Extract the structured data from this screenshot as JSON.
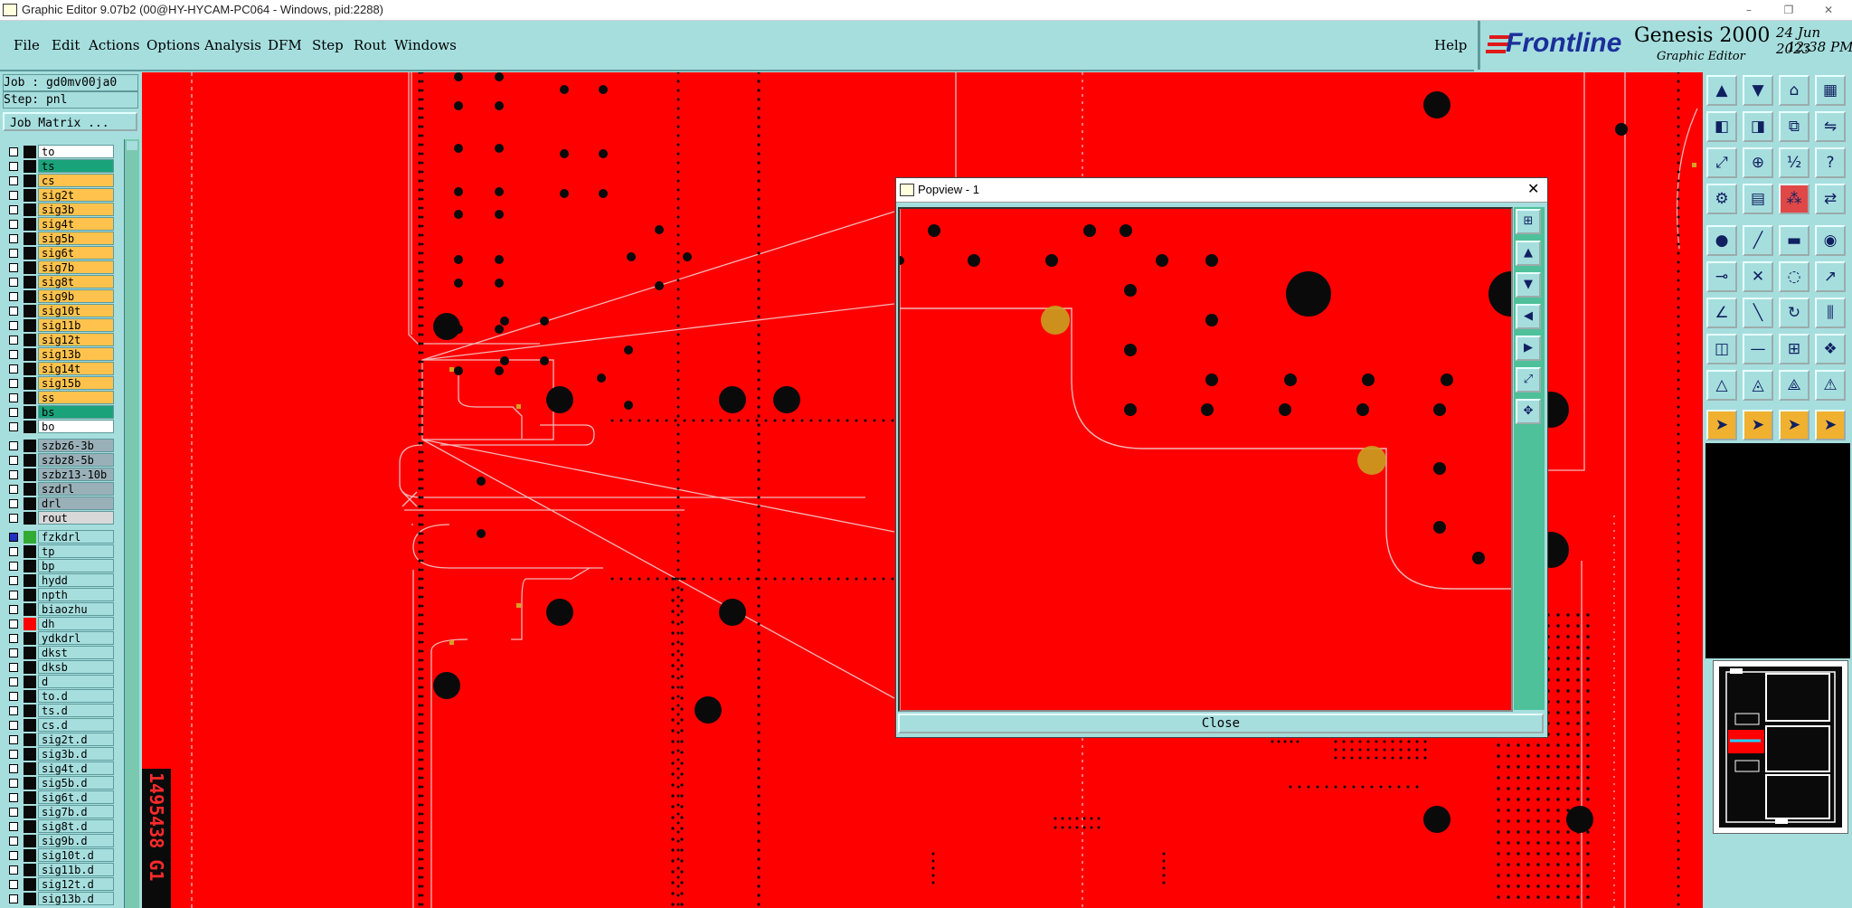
{
  "window": {
    "title": "Graphic Editor 9.07b2 (00@HY-HYCAM-PC064 - Windows, pid:2288)",
    "controls": [
      "–",
      "❐",
      "✕"
    ]
  },
  "menubar": {
    "items": [
      "File",
      "Edit",
      "Actions",
      "Options",
      "Analysis",
      "DFM",
      "Step",
      "Rout",
      "Windows"
    ],
    "help": "Help"
  },
  "brand": {
    "logo": "Frontline",
    "product": "Genesis 2000",
    "subtitle": "Graphic Editor",
    "date": "24 Jun 2023",
    "time": "12:38 PM"
  },
  "job": {
    "job_label": "Job : gd0mv00ja0",
    "step_label": "Step: pnl",
    "matrix_button": "Job Matrix ..."
  },
  "layers_group1": [
    {
      "name": "to",
      "color": "#ffffff",
      "swatch": "#0a0a0a"
    },
    {
      "name": "ts",
      "color": "#1aa37a",
      "swatch": "#0a0a0a"
    },
    {
      "name": "cs",
      "color": "#ffc34d",
      "swatch": "#0a0a0a"
    },
    {
      "name": "sig2t",
      "color": "#ffc34d",
      "swatch": "#0a0a0a"
    },
    {
      "name": "sig3b",
      "color": "#ffc34d",
      "swatch": "#0a0a0a"
    },
    {
      "name": "sig4t",
      "color": "#ffc34d",
      "swatch": "#0a0a0a"
    },
    {
      "name": "sig5b",
      "color": "#ffc34d",
      "swatch": "#0a0a0a"
    },
    {
      "name": "sig6t",
      "color": "#ffc34d",
      "swatch": "#0a0a0a"
    },
    {
      "name": "sig7b",
      "color": "#ffc34d",
      "swatch": "#0a0a0a"
    },
    {
      "name": "sig8t",
      "color": "#ffc34d",
      "swatch": "#0a0a0a"
    },
    {
      "name": "sig9b",
      "color": "#ffc34d",
      "swatch": "#0a0a0a"
    },
    {
      "name": "sig10t",
      "color": "#ffc34d",
      "swatch": "#0a0a0a"
    },
    {
      "name": "sig11b",
      "color": "#ffc34d",
      "swatch": "#0a0a0a"
    },
    {
      "name": "sig12t",
      "color": "#ffc34d",
      "swatch": "#0a0a0a"
    },
    {
      "name": "sig13b",
      "color": "#ffc34d",
      "swatch": "#0a0a0a"
    },
    {
      "name": "sig14t",
      "color": "#ffc34d",
      "swatch": "#0a0a0a"
    },
    {
      "name": "sig15b",
      "color": "#ffc34d",
      "swatch": "#0a0a0a"
    },
    {
      "name": "ss",
      "color": "#ffc34d",
      "swatch": "#0a0a0a"
    },
    {
      "name": "bs",
      "color": "#1aa37a",
      "swatch": "#0a0a0a"
    },
    {
      "name": "bo",
      "color": "#ffffff",
      "swatch": "#0a0a0a"
    }
  ],
  "layers_group2": [
    {
      "name": "szbz6-3b",
      "color": "#9ab0b8",
      "swatch": "#0a0a0a"
    },
    {
      "name": "szbz8-5b",
      "color": "#9ab0b8",
      "swatch": "#0a0a0a"
    },
    {
      "name": "szbz13-10b",
      "color": "#9ab0b8",
      "swatch": "#0a0a0a"
    },
    {
      "name": "szdrl",
      "color": "#9ab0b8",
      "swatch": "#0a0a0a"
    },
    {
      "name": "drl",
      "color": "#9ab0b8",
      "swatch": "#0a0a0a"
    },
    {
      "name": "rout",
      "color": "#d8d8d8",
      "swatch": "#0a0a0a"
    }
  ],
  "layers_group3": [
    {
      "name": "fzkdrl",
      "color": "#a6dede",
      "swatch": "#33aa33",
      "work": true
    },
    {
      "name": "tp",
      "color": "#a6dede",
      "swatch": "#0a0a0a"
    },
    {
      "name": "bp",
      "color": "#a6dede",
      "swatch": "#0a0a0a"
    },
    {
      "name": "hydd",
      "color": "#a6dede",
      "swatch": "#0a0a0a"
    },
    {
      "name": "npth",
      "color": "#a6dede",
      "swatch": "#0a0a0a"
    },
    {
      "name": "biaozhu",
      "color": "#a6dede",
      "swatch": "#0a0a0a"
    },
    {
      "name": "dh",
      "color": "#a6dede",
      "swatch": "#ff0000"
    },
    {
      "name": "ydkdrl",
      "color": "#a6dede",
      "swatch": "#0a0a0a"
    },
    {
      "name": "dkst",
      "color": "#a6dede",
      "swatch": "#0a0a0a"
    },
    {
      "name": "dksb",
      "color": "#a6dede",
      "swatch": "#0a0a0a"
    },
    {
      "name": "d",
      "color": "#a6dede",
      "swatch": "#0a0a0a"
    },
    {
      "name": "to.d",
      "color": "#a6dede",
      "swatch": "#0a0a0a"
    },
    {
      "name": "ts.d",
      "color": "#a6dede",
      "swatch": "#0a0a0a"
    },
    {
      "name": "cs.d",
      "color": "#a6dede",
      "swatch": "#0a0a0a"
    },
    {
      "name": "sig2t.d",
      "color": "#a6dede",
      "swatch": "#0a0a0a"
    },
    {
      "name": "sig3b.d",
      "color": "#a6dede",
      "swatch": "#0a0a0a"
    },
    {
      "name": "sig4t.d",
      "color": "#a6dede",
      "swatch": "#0a0a0a"
    },
    {
      "name": "sig5b.d",
      "color": "#a6dede",
      "swatch": "#0a0a0a"
    },
    {
      "name": "sig6t.d",
      "color": "#a6dede",
      "swatch": "#0a0a0a"
    },
    {
      "name": "sig7b.d",
      "color": "#a6dede",
      "swatch": "#0a0a0a"
    },
    {
      "name": "sig8t.d",
      "color": "#a6dede",
      "swatch": "#0a0a0a"
    },
    {
      "name": "sig9b.d",
      "color": "#a6dede",
      "swatch": "#0a0a0a"
    },
    {
      "name": "sig10t.d",
      "color": "#a6dede",
      "swatch": "#0a0a0a"
    },
    {
      "name": "sig11b.d",
      "color": "#a6dede",
      "swatch": "#0a0a0a"
    },
    {
      "name": "sig12t.d",
      "color": "#a6dede",
      "swatch": "#0a0a0a"
    },
    {
      "name": "sig13b.d",
      "color": "#a6dede",
      "swatch": "#0a0a0a"
    }
  ],
  "canvas": {
    "background": "#ff0000",
    "vertical_text": "1495438  G1"
  },
  "popview": {
    "title": "Popview - 1",
    "close_label": "Close"
  },
  "toolbar_icons": [
    "open-job-icon",
    "save-icon",
    "home-icon",
    "grid-layout-icon",
    "import-icon",
    "export-icon",
    "copy-icon",
    "flip-icon",
    "zoom-fit-icon",
    "zoom-center-icon",
    "scale-1-2-icon",
    "help-icon",
    "measure-settings-icon",
    "grid-icon",
    "netlist-icon",
    "compare-icon",
    "drill-icon",
    "line-draw-icon",
    "ruler-icon",
    "pad-icon",
    "connect-icon",
    "cross-icon",
    "snap-icon",
    "route-icon",
    "angle-icon",
    "slope-icon",
    "rotate-icon",
    "mirror-icon",
    "select-area-icon",
    "minus-icon",
    "split-icon",
    "group-icon",
    "triangle-a-icon",
    "triangle-b-icon",
    "triangle-c-icon",
    "triangle-d-icon",
    "pointer-icon",
    "pointer-plus-icon",
    "pointer-move-icon",
    "pointer-multi-icon"
  ]
}
